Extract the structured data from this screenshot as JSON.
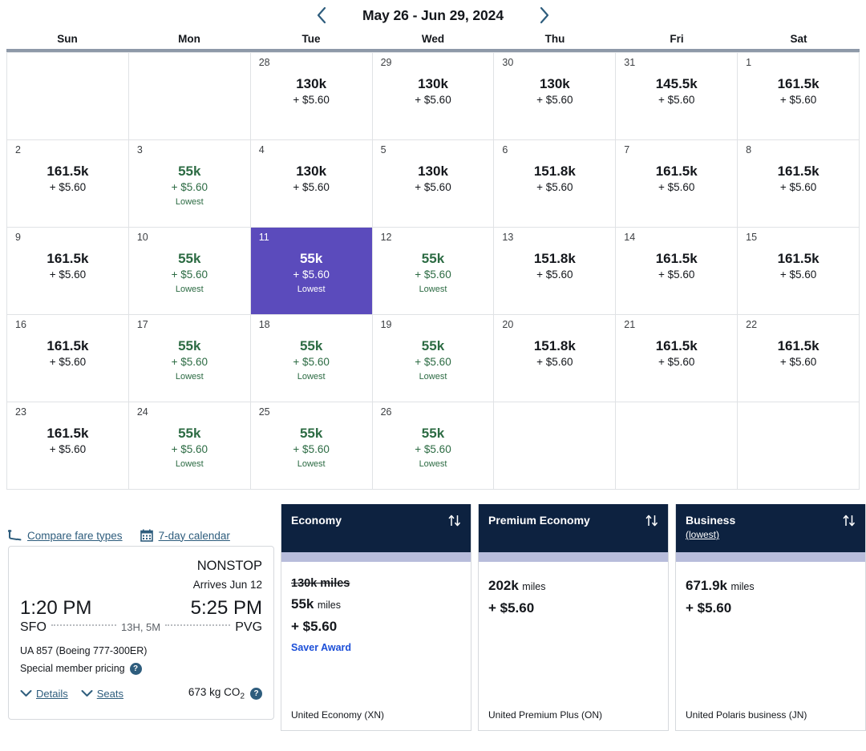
{
  "calendar": {
    "range_label": "May 26 - Jun 29, 2024",
    "prev_label": "Previous dates",
    "next_label": "Next dates",
    "dow": [
      "Sun",
      "Mon",
      "Tue",
      "Wed",
      "Thu",
      "Fri",
      "Sat"
    ],
    "tax": "+ $5.60",
    "lowest_tag": "Lowest",
    "selected_day": 11,
    "selected_color": "#5b4bbc",
    "lowest_color": "#2c6b43",
    "weeks": [
      [
        {
          "day": null
        },
        {
          "day": null
        },
        {
          "day": "28",
          "miles": "130k",
          "tax": "+ $5.60",
          "tag": "",
          "low": false
        },
        {
          "day": "29",
          "miles": "130k",
          "tax": "+ $5.60",
          "tag": "",
          "low": false
        },
        {
          "day": "30",
          "miles": "130k",
          "tax": "+ $5.60",
          "tag": "",
          "low": false
        },
        {
          "day": "31",
          "miles": "145.5k",
          "tax": "+ $5.60",
          "tag": "",
          "low": false
        },
        {
          "day": "1",
          "miles": "161.5k",
          "tax": "+ $5.60",
          "tag": "",
          "low": false
        }
      ],
      [
        {
          "day": "2",
          "miles": "161.5k",
          "tax": "+ $5.60",
          "tag": "",
          "low": false
        },
        {
          "day": "3",
          "miles": "55k",
          "tax": "+ $5.60",
          "tag": "Lowest",
          "low": true
        },
        {
          "day": "4",
          "miles": "130k",
          "tax": "+ $5.60",
          "tag": "",
          "low": false
        },
        {
          "day": "5",
          "miles": "130k",
          "tax": "+ $5.60",
          "tag": "",
          "low": false
        },
        {
          "day": "6",
          "miles": "151.8k",
          "tax": "+ $5.60",
          "tag": "",
          "low": false
        },
        {
          "day": "7",
          "miles": "161.5k",
          "tax": "+ $5.60",
          "tag": "",
          "low": false
        },
        {
          "day": "8",
          "miles": "161.5k",
          "tax": "+ $5.60",
          "tag": "",
          "low": false
        }
      ],
      [
        {
          "day": "9",
          "miles": "161.5k",
          "tax": "+ $5.60",
          "tag": "",
          "low": false
        },
        {
          "day": "10",
          "miles": "55k",
          "tax": "+ $5.60",
          "tag": "Lowest",
          "low": true
        },
        {
          "day": "11",
          "miles": "55k",
          "tax": "+ $5.60",
          "tag": "Lowest",
          "low": true,
          "selected": true
        },
        {
          "day": "12",
          "miles": "55k",
          "tax": "+ $5.60",
          "tag": "Lowest",
          "low": true
        },
        {
          "day": "13",
          "miles": "151.8k",
          "tax": "+ $5.60",
          "tag": "",
          "low": false
        },
        {
          "day": "14",
          "miles": "161.5k",
          "tax": "+ $5.60",
          "tag": "",
          "low": false
        },
        {
          "day": "15",
          "miles": "161.5k",
          "tax": "+ $5.60",
          "tag": "",
          "low": false
        }
      ],
      [
        {
          "day": "16",
          "miles": "161.5k",
          "tax": "+ $5.60",
          "tag": "",
          "low": false
        },
        {
          "day": "17",
          "miles": "55k",
          "tax": "+ $5.60",
          "tag": "Lowest",
          "low": true
        },
        {
          "day": "18",
          "miles": "55k",
          "tax": "+ $5.60",
          "tag": "Lowest",
          "low": true
        },
        {
          "day": "19",
          "miles": "55k",
          "tax": "+ $5.60",
          "tag": "Lowest",
          "low": true
        },
        {
          "day": "20",
          "miles": "151.8k",
          "tax": "+ $5.60",
          "tag": "",
          "low": false
        },
        {
          "day": "21",
          "miles": "161.5k",
          "tax": "+ $5.60",
          "tag": "",
          "low": false
        },
        {
          "day": "22",
          "miles": "161.5k",
          "tax": "+ $5.60",
          "tag": "",
          "low": false
        }
      ],
      [
        {
          "day": "23",
          "miles": "161.5k",
          "tax": "+ $5.60",
          "tag": "",
          "low": false
        },
        {
          "day": "24",
          "miles": "55k",
          "tax": "+ $5.60",
          "tag": "Lowest",
          "low": true
        },
        {
          "day": "25",
          "miles": "55k",
          "tax": "+ $5.60",
          "tag": "Lowest",
          "low": true
        },
        {
          "day": "26",
          "miles": "55k",
          "tax": "+ $5.60",
          "tag": "Lowest",
          "low": true
        },
        {
          "day": null
        },
        {
          "day": null
        },
        {
          "day": null
        }
      ]
    ]
  },
  "links": {
    "compare": "Compare fare types",
    "seven_day": "7-day calendar"
  },
  "flight": {
    "nonstop": "NONSTOP",
    "arrives": "Arrives Jun 12",
    "depart_time": "1:20 PM",
    "arrive_time": "5:25 PM",
    "origin": "SFO",
    "destination": "PVG",
    "duration": "13H, 5M",
    "equipment": "UA 857 (Boeing 777-300ER)",
    "member_pricing": "Special member pricing",
    "details": "Details",
    "seats": "Seats",
    "co2": "673 kg CO",
    "co2_sub": "2",
    "help": "?"
  },
  "fares": [
    {
      "title": "Economy",
      "subtitle": "",
      "struck": "130k miles",
      "miles": "55k",
      "miles_unit": "miles",
      "tax": "+ $5.60",
      "badge": "Saver Award",
      "footer": "United Economy (XN)"
    },
    {
      "title": "Premium Economy",
      "subtitle": "",
      "struck": "",
      "miles": "202k",
      "miles_unit": "miles",
      "tax": "+ $5.60",
      "badge": "",
      "footer": "United Premium Plus (ON)"
    },
    {
      "title": "Business",
      "subtitle": "(lowest)",
      "struck": "",
      "miles": "671.9k",
      "miles_unit": "miles",
      "tax": "+ $5.60",
      "badge": "",
      "footer": "United Polaris business (JN)"
    }
  ],
  "colors": {
    "navy": "#0d2240",
    "accent_lavender": "#b7bcdb",
    "selected_purple": "#5b4bbc",
    "lowest_green": "#2c6b43",
    "link_blue": "#2e5d7d",
    "saver_blue": "#1c4fd8"
  }
}
